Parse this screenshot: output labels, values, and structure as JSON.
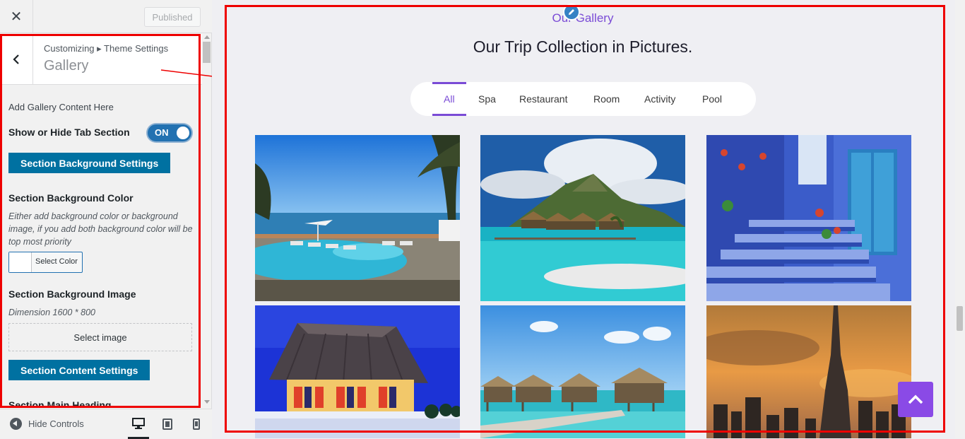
{
  "topbar": {
    "close_label": "✕",
    "published_label": "Published"
  },
  "section": {
    "breadcrumb": "Customizing ▸ Theme Settings",
    "title": "Gallery"
  },
  "controls": {
    "intro": "Add Gallery Content Here",
    "show_tab_label": "Show or Hide Tab Section",
    "toggle_state": "ON",
    "bg_settings_button": "Section Background Settings",
    "bg_color_label": "Section Background Color",
    "bg_color_desc": "Either add background color or background image, if you add both background color will be top most priority",
    "select_color_label": "Select Color",
    "bg_image_label": "Section Background Image",
    "dimension_text": "Dimension 1600 * 800",
    "select_image_label": "Select image",
    "content_settings_button": "Section Content Settings",
    "main_heading_label": "Section Main Heading"
  },
  "footer": {
    "hide_controls_label": "Hide Controls",
    "devices": [
      "desktop-icon",
      "tablet-icon",
      "mobile-icon"
    ]
  },
  "preview": {
    "eyebrow": "Our Gallery",
    "heading": "Our Trip Collection in Pictures.",
    "tabs": [
      {
        "label": "All",
        "active": true
      },
      {
        "label": "Spa",
        "active": false
      },
      {
        "label": "Restaurant",
        "active": false
      },
      {
        "label": "Room",
        "active": false
      },
      {
        "label": "Activity",
        "active": false
      },
      {
        "label": "Pool",
        "active": false
      }
    ],
    "photos": [
      "beach-resort-pool",
      "bora-bora-bungalows",
      "blue-alley-stairs",
      "hut-at-night",
      "water-villas",
      "city-sunset-tower"
    ]
  },
  "colors": {
    "accent": "#7a4bd6",
    "wp_blue": "#0071a1",
    "highlight_red": "#ee0000",
    "back_to_top": "#8a4ae6"
  }
}
